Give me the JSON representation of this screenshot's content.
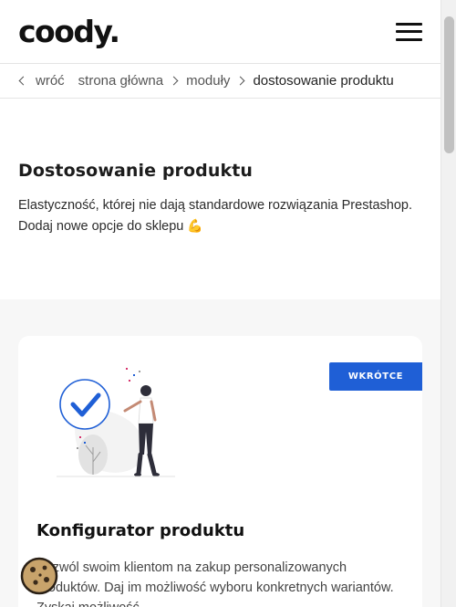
{
  "header": {
    "logo": "coody.",
    "menu_icon": "hamburger-menu-icon"
  },
  "breadcrumb": {
    "back": "wróć",
    "items": [
      "strona główna",
      "moduły"
    ],
    "current": "dostosowanie produktu"
  },
  "hero": {
    "title": "Dostosowanie produktu",
    "description": "Elastyczność, której nie dają standardowe rozwiązania Prestashop. Dodaj nowe opcje do sklepu",
    "emoji": "💪"
  },
  "card": {
    "badge": "WKRÓTCE",
    "title": "Konfigurator produktu",
    "description": "Pozwól swoim klientom na zakup personalizowanych produktów. Daj im możliwość wyboru konkretnych wariantów. Zyskaj możliwość"
  },
  "colors": {
    "accent": "#1f5fd6",
    "section_bg": "#f7f7f7"
  },
  "icons": {
    "cookie": "cookie-icon",
    "check": "check-circle-icon"
  }
}
